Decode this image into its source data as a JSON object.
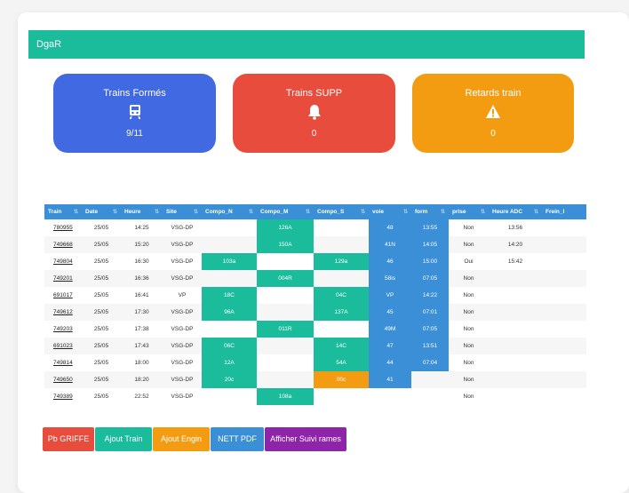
{
  "header": {
    "title": "DgaR"
  },
  "stats": [
    {
      "title": "Trains Formés",
      "value": "9/11",
      "icon": "train-icon",
      "color": "#4169e1"
    },
    {
      "title": "Trains SUPP",
      "value": "0",
      "icon": "bell-icon",
      "color": "#e74c3c"
    },
    {
      "title": "Retards train",
      "value": "0",
      "icon": "warning-icon",
      "color": "#f39c12"
    }
  ],
  "table": {
    "columns": [
      "Train",
      "Date",
      "Heure",
      "Site",
      "Compo_N",
      "Compo_M",
      "Compo_S",
      "voie",
      "form",
      "prise",
      "Heure ADC",
      "Frein_I"
    ],
    "rows": [
      [
        "780955",
        "25/05",
        "14:25",
        "VSG-DP",
        "",
        "126A",
        "",
        "48",
        "13:55",
        "Non",
        "13:56",
        ""
      ],
      [
        "749668",
        "25/05",
        "15:20",
        "VSG-DP",
        "",
        "150A",
        "",
        "41N",
        "14:05",
        "Non",
        "14:20",
        ""
      ],
      [
        "749804",
        "25/05",
        "16:30",
        "VSG-DP",
        "103a",
        "",
        "129a",
        "46",
        "15:00",
        "Oui",
        "15:42",
        ""
      ],
      [
        "749201",
        "25/05",
        "16:36",
        "VSG-DP",
        "",
        "004R",
        "",
        "58is",
        "07:05",
        "Non",
        "",
        ""
      ],
      [
        "691017",
        "25/05",
        "16:41",
        "VP",
        "18C",
        "",
        "04C",
        "VP",
        "14:22",
        "Non",
        "",
        ""
      ],
      [
        "749612",
        "25/05",
        "17:30",
        "VSG-DP",
        "96A",
        "",
        "137A",
        "45",
        "07:01",
        "Non",
        "",
        ""
      ],
      [
        "749203",
        "25/05",
        "17:38",
        "VSG-DP",
        "",
        "011R",
        "",
        "49M",
        "07:05",
        "Non",
        "",
        ""
      ],
      [
        "691023",
        "25/05",
        "17:43",
        "VSG-DP",
        "06C",
        "",
        "14C",
        "47",
        "13:51",
        "Non",
        "",
        ""
      ],
      [
        "749814",
        "25/05",
        "18:00",
        "VSG-DP",
        "12A",
        "",
        "54A",
        "44",
        "07:04",
        "Non",
        "",
        ""
      ],
      [
        "749650",
        "25/05",
        "18:20",
        "VSG-DP",
        "20c",
        "",
        "00c",
        "41",
        "",
        "Non",
        "",
        ""
      ],
      [
        "749389",
        "25/05",
        "22:52",
        "VSG-DP",
        "",
        "108a",
        "",
        "",
        "",
        "Non",
        "",
        ""
      ]
    ]
  },
  "buttons": [
    {
      "label": "Pb GRIFFE",
      "color": "#e74c3c"
    },
    {
      "label": "Ajout Train",
      "color": "#1abc9c"
    },
    {
      "label": "Ajout Engin",
      "color": "#f39c12"
    },
    {
      "label": "NETT PDF",
      "color": "#3a8fd6"
    },
    {
      "label": "Afficher Suivi rames",
      "color": "#8e24aa"
    }
  ],
  "colors": {
    "green": "#1abc9c",
    "blue": "#3a8fd6",
    "orange": "#f39c12",
    "red": "#e74c3c"
  }
}
